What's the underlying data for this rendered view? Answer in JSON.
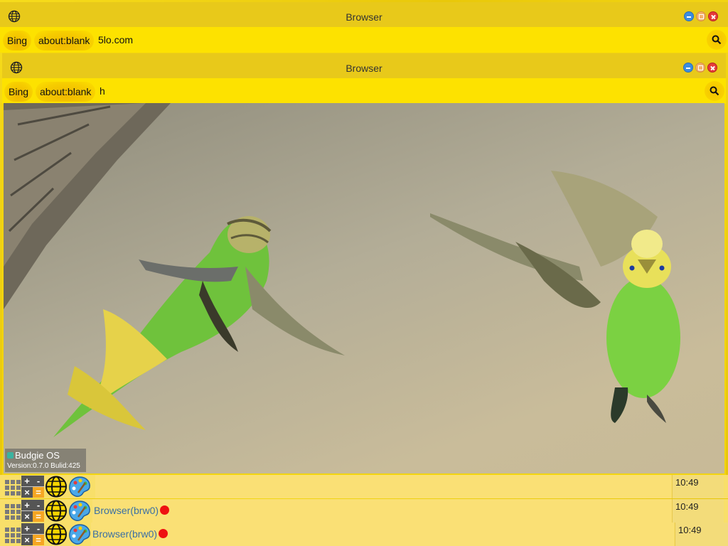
{
  "outer_window": {
    "title": "Browser",
    "bookmarks": [
      "Bing",
      "about:blank"
    ],
    "url": "5lo.com"
  },
  "inner_window": {
    "title": "Browser",
    "bookmarks": [
      "Bing",
      "about:blank"
    ],
    "url": "h"
  },
  "content_image": "two-budgerigars-in-flight",
  "os_badge": {
    "name": "Budgie OS",
    "version": "Version:0.7.0  Bulid:425"
  },
  "taskbars": [
    {
      "task": "",
      "clock": "10:49"
    },
    {
      "task": "Browser(brw0)",
      "clock": "10:49"
    },
    {
      "task": "Browser(brw0)",
      "clock": "10:49"
    }
  ],
  "colors": {
    "titlebar": "#e8c91a",
    "addressbar": "#fde200",
    "taskbar": "#f8df6a",
    "task_dot": "#ee1111"
  }
}
